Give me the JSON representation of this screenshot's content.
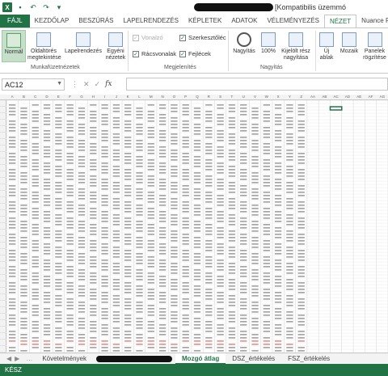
{
  "window": {
    "title_suffix": "[Kompatibilis üzemmó"
  },
  "ribbon": {
    "tabs": [
      "FÁJL",
      "KEZDŐLAP",
      "BESZÚRÁS",
      "LAPELRENDEZÉS",
      "KÉPLETEK",
      "ADATOK",
      "VÉLEMÉNYEZÉS",
      "NÉZET",
      "Nuance PDF"
    ],
    "active_tab": "NÉZET",
    "groups": {
      "workbook_views": {
        "label": "Munkafüzetnézetek",
        "normal": "Normál",
        "page_break": "Oldaltörés megtekintése",
        "page_layout": "Lapelrendezés",
        "custom": "Egyéni nézetek"
      },
      "show": {
        "label": "Megjelenítés",
        "ruler": "Vonalzó",
        "formula_bar": "Szerkesztőléc",
        "gridlines": "Rácsvonalak",
        "headings": "Fejlécek"
      },
      "zoom": {
        "label": "Nagyítás",
        "zoom": "Nagyítás",
        "hundred": "100%",
        "to_selection": "Kijelölt rész nagyítása"
      },
      "window": {
        "new_window": "Új ablak",
        "arrange": "Mozaik",
        "freeze": "Panelek rögzítése"
      }
    }
  },
  "formula_bar": {
    "name_box": "AC12",
    "formula": ""
  },
  "sheet": {
    "columns": [
      "A",
      "B",
      "C",
      "D",
      "E",
      "F",
      "G",
      "H",
      "I",
      "J",
      "K",
      "L",
      "M",
      "N",
      "O",
      "P",
      "Q",
      "R",
      "S",
      "T",
      "U",
      "V",
      "W",
      "X",
      "Y",
      "Z",
      "AA",
      "AB",
      "AC",
      "AD",
      "AE",
      "AF",
      "AG"
    ],
    "selected_cell": "AC12"
  },
  "sheet_tabs": [
    "Követelmények",
    "Mozgó átlag",
    "DSZ_értékelés",
    "FSZ_értékelés"
  ],
  "active_sheet": "Mozgó átlag",
  "status": "KÉSZ"
}
